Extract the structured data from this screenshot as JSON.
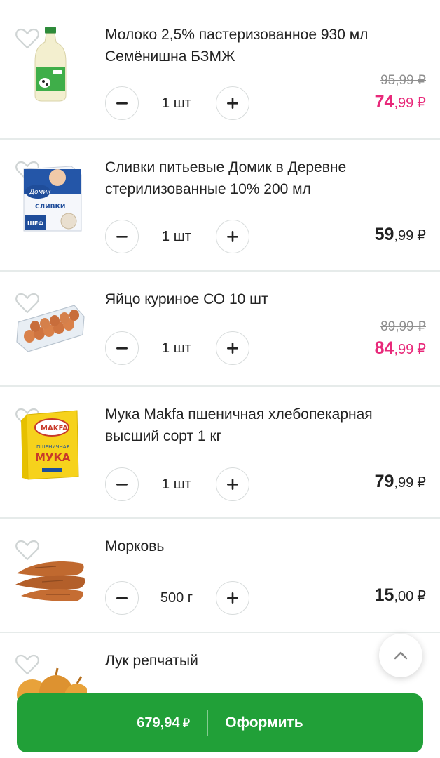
{
  "currency": "₽",
  "items": [
    {
      "name_line1": "Молоко 2,5% пастеризованное 930 мл",
      "name_line2": "Семёнишна БЗМЖ",
      "image_icon": "milk-bottle-image",
      "quantity": "1 шт",
      "old_price": "95,99 ₽",
      "price_int": "74",
      "price_frac": ",99",
      "on_sale": true
    },
    {
      "name_line1": "Сливки питьевые Домик в Деревне",
      "name_line2": "стерилизованные 10% 200 мл",
      "image_icon": "cream-carton-image",
      "quantity": "1 шт",
      "old_price": "",
      "price_int": "59",
      "price_frac": ",99",
      "on_sale": false
    },
    {
      "name_line1": "Яйцо куриное СО 10 шт",
      "name_line2": "",
      "image_icon": "eggs-carton-image",
      "quantity": "1 шт",
      "old_price": "89,99 ₽",
      "price_int": "84",
      "price_frac": ",99",
      "on_sale": true
    },
    {
      "name_line1": "Мука Makfa пшеничная хлебопекарная",
      "name_line2": "высший сорт 1 кг",
      "image_icon": "flour-pack-image",
      "quantity": "1 шт",
      "old_price": "",
      "price_int": "79",
      "price_frac": ",99",
      "on_sale": false
    },
    {
      "name_line1": "Морковь",
      "name_line2": "",
      "image_icon": "carrots-image",
      "quantity": "500 г",
      "old_price": "",
      "price_int": "15",
      "price_frac": ",00",
      "on_sale": false
    },
    {
      "name_line1": "Лук репчатый",
      "name_line2": "",
      "image_icon": "onions-image"
    }
  ],
  "checkout": {
    "total": "679,94",
    "label": "Оформить"
  },
  "colors": {
    "accent": "#21a038",
    "sale": "#e8297a"
  }
}
